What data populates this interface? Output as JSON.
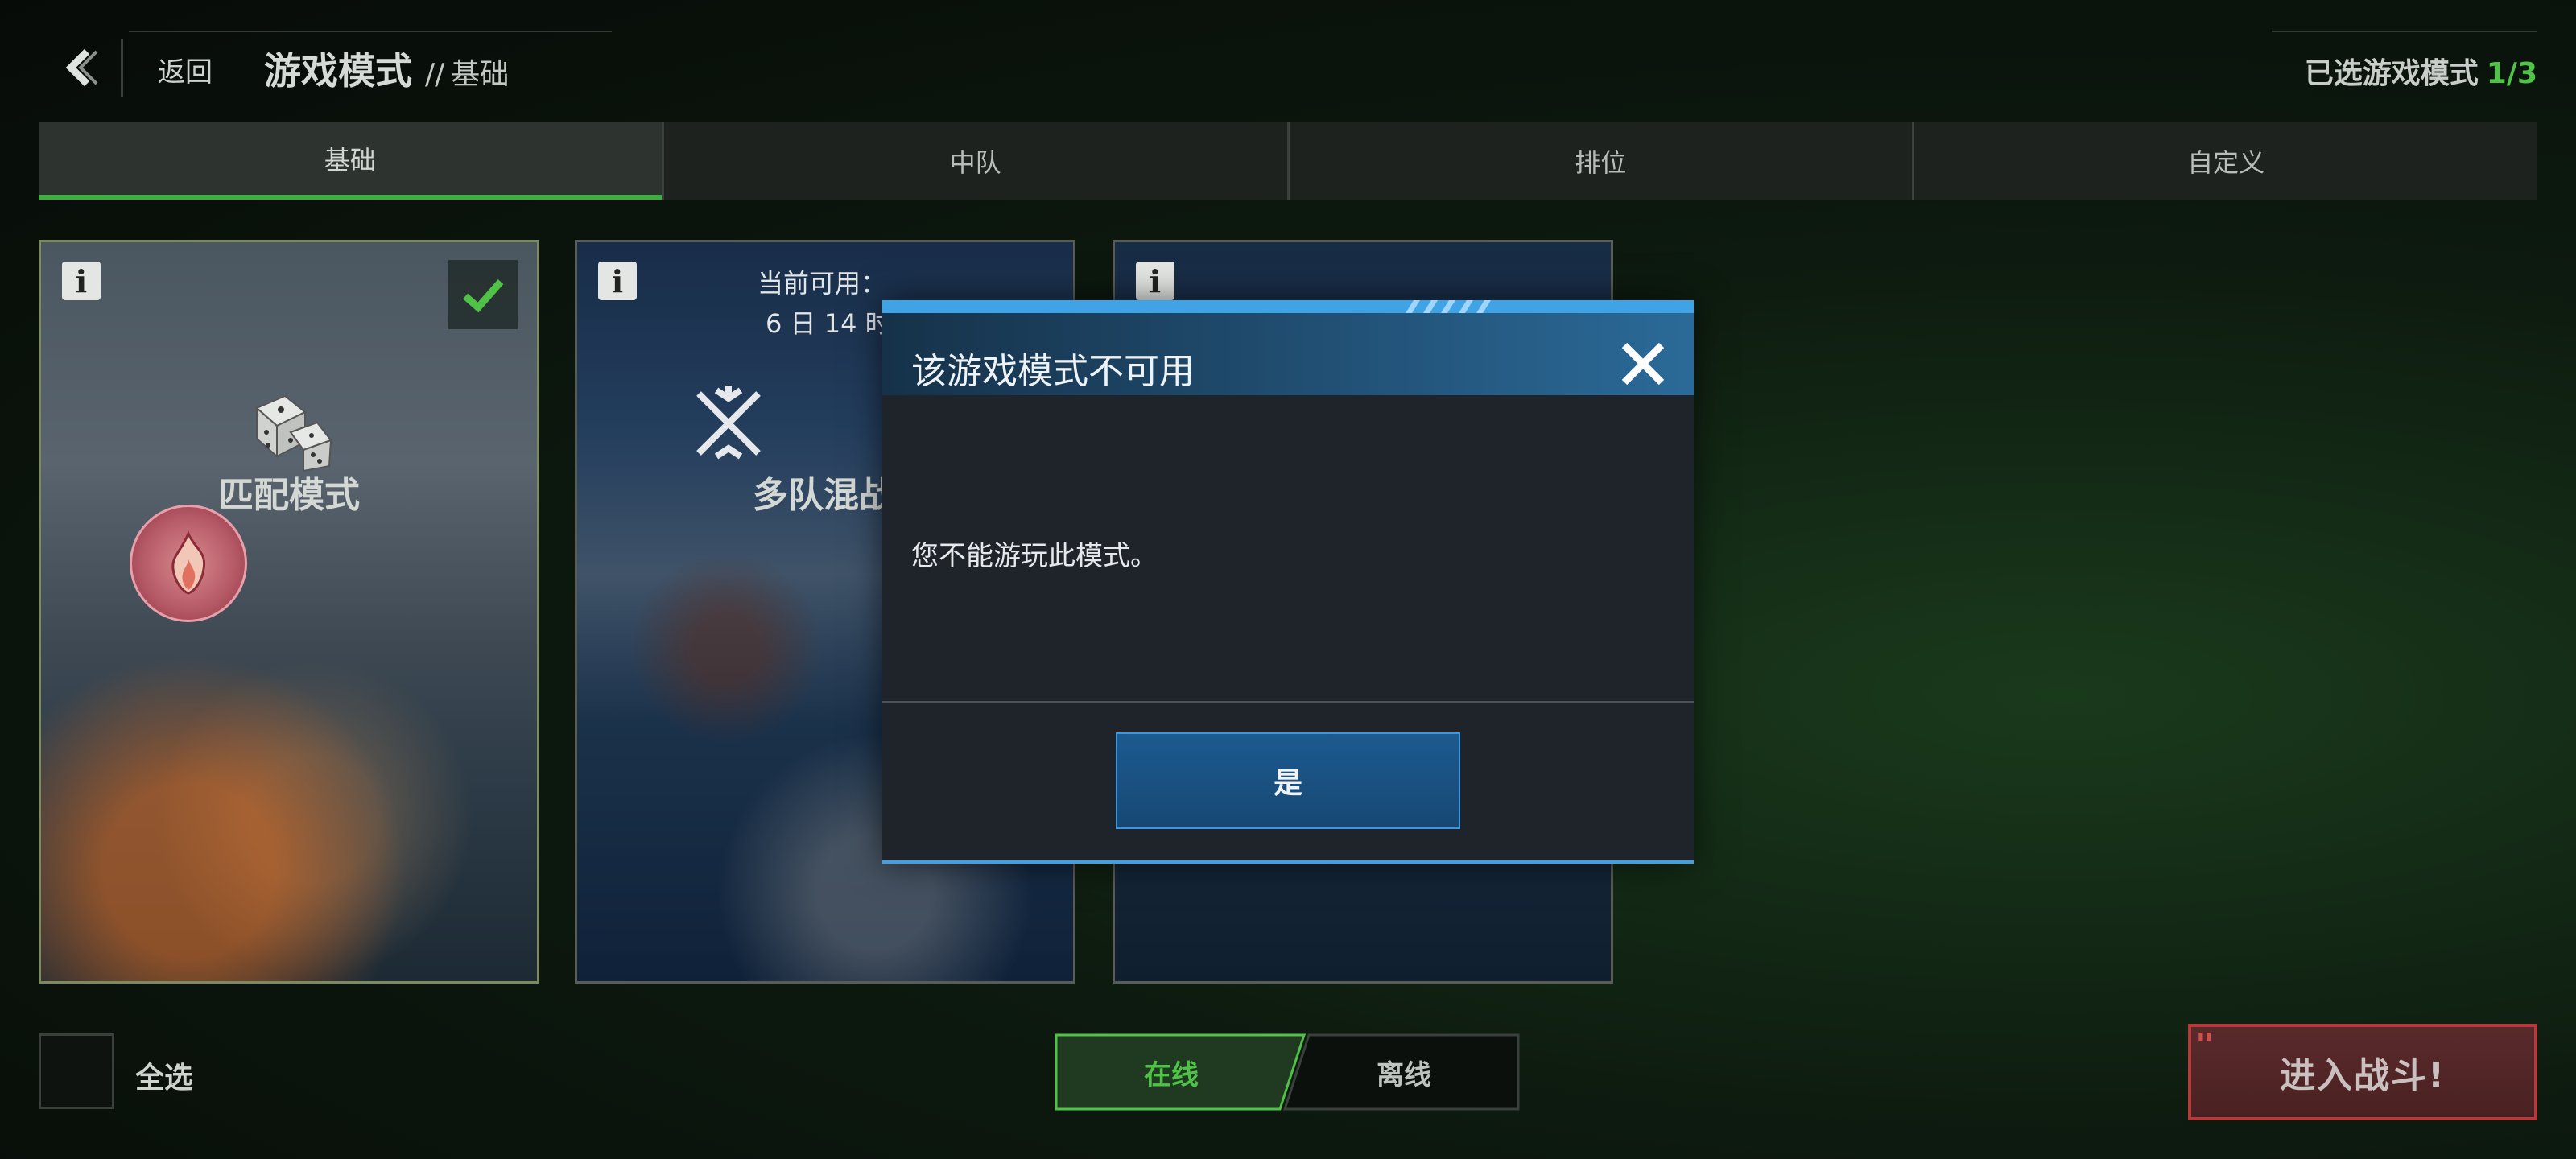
{
  "header": {
    "back_label": "返回",
    "title": "游戏模式",
    "title_sep": "//",
    "subtitle": "基础",
    "selected_label": "已选游戏模式",
    "selected_count": "1/3"
  },
  "tabs": [
    {
      "label": "基础",
      "active": true
    },
    {
      "label": "中队",
      "active": false
    },
    {
      "label": "排位",
      "active": false
    },
    {
      "label": "自定义",
      "active": false
    }
  ],
  "cards": [
    {
      "name": "匹配模式",
      "selected": true,
      "icon": "dice-icon"
    },
    {
      "name": "多队混战",
      "availability_label": "当前可用：",
      "availability_time": "6 日 14 时",
      "icon": "crossed-swords-icon"
    },
    {
      "name": "",
      "icon": ""
    }
  ],
  "modal": {
    "title": "该游戏模式不可用",
    "message": "您不能游玩此模式。",
    "confirm_label": "是"
  },
  "footer": {
    "select_all_label": "全选",
    "online_label": "在线",
    "offline_label": "离线",
    "battle_label": "进入战斗!"
  },
  "colors": {
    "accent_green": "#4fc247",
    "modal_blue": "#3fa3e6",
    "battle_red": "#b43a3c"
  }
}
